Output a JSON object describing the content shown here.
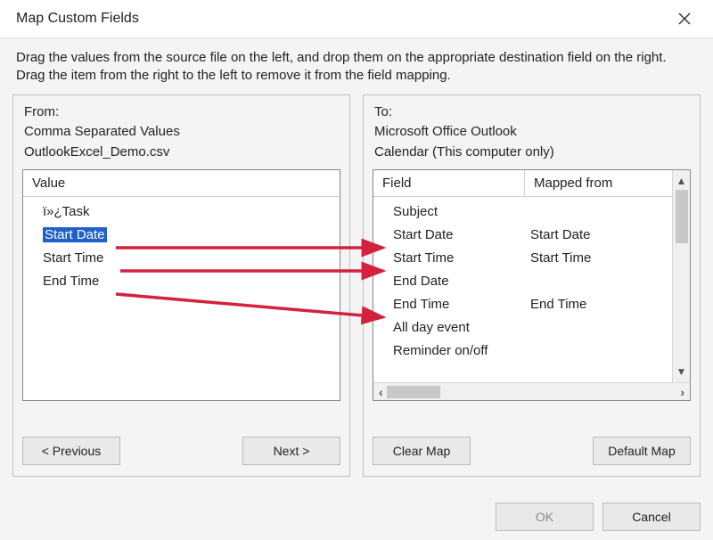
{
  "window": {
    "title": "Map Custom Fields"
  },
  "instructions": "Drag the values from the source file on the left, and drop them on the appropriate destination field on the right.  Drag the item from the right to the left to remove it from the field mapping.",
  "from_panel": {
    "label": "From:",
    "source_type": "Comma Separated Values",
    "source_file": "OutlookExcel_Demo.csv",
    "column_header": "Value",
    "items": [
      {
        "text": "ï»¿Task",
        "selected": false
      },
      {
        "text": "Start Date",
        "selected": true
      },
      {
        "text": "Start Time",
        "selected": false
      },
      {
        "text": "End Time",
        "selected": false
      }
    ],
    "buttons": {
      "previous": "< Previous",
      "next": "Next >"
    }
  },
  "to_panel": {
    "label": "To:",
    "dest_app": "Microsoft Office Outlook",
    "dest_folder": "Calendar (This computer only)",
    "column_headers": {
      "field": "Field",
      "mapped": "Mapped from"
    },
    "rows": [
      {
        "field": "Subject",
        "mapped": ""
      },
      {
        "field": "Start Date",
        "mapped": "Start Date"
      },
      {
        "field": "Start Time",
        "mapped": "Start Time"
      },
      {
        "field": "End Date",
        "mapped": ""
      },
      {
        "field": "End Time",
        "mapped": "End Time"
      },
      {
        "field": "All day event",
        "mapped": ""
      },
      {
        "field": "Reminder on/off",
        "mapped": ""
      }
    ],
    "buttons": {
      "clear": "Clear Map",
      "default": "Default Map"
    }
  },
  "footer": {
    "ok": "OK",
    "cancel": "Cancel"
  }
}
